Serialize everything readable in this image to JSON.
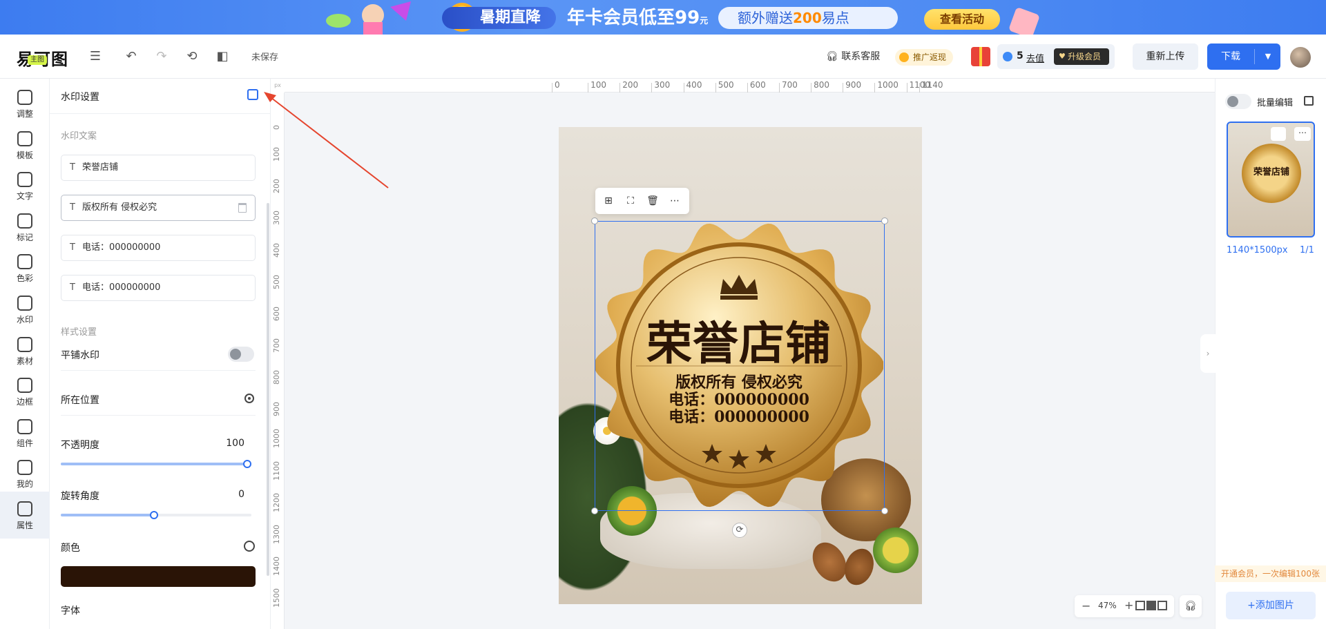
{
  "banner": {
    "pill1": "暑期直降",
    "pill2": "年卡会员低至99",
    "pill2_unit": "元",
    "pill3_prefix": "额外赠送",
    "pill3_number": "200",
    "pill3_suffix": "易点",
    "cta": "查看活动"
  },
  "topbar": {
    "logo": "易可图",
    "unsaved": "未保存",
    "contact": "联系客服",
    "promo": "推广返现",
    "points_count": "5",
    "recharge": "去值",
    "upgrade": "升级会员",
    "reupload": "重新上传",
    "download": "下载"
  },
  "rail": {
    "badge": "主图",
    "items": [
      {
        "label": "调整",
        "icon": "sliders-icon"
      },
      {
        "label": "模板",
        "icon": "template-grid-icon"
      },
      {
        "label": "文字",
        "icon": "text-icon"
      },
      {
        "label": "标记",
        "icon": "mark-icon"
      },
      {
        "label": "色彩",
        "icon": "palette-icon"
      },
      {
        "label": "水印",
        "icon": "stamp-icon"
      },
      {
        "label": "素材",
        "icon": "material-icon"
      },
      {
        "label": "边框",
        "icon": "border-icon"
      },
      {
        "label": "组件",
        "icon": "component-cube-icon"
      },
      {
        "label": "我的",
        "icon": "user-icon"
      },
      {
        "label": "属性",
        "icon": "layers-icon"
      }
    ],
    "active_index": 10
  },
  "panel": {
    "title": "水印设置",
    "text_section": "水印文案",
    "watermark_texts": [
      "荣誉店铺",
      "版权所有 侵权必究",
      "电话：000000000",
      "电话：000000000"
    ],
    "style_section": "样式设置",
    "tile_watermark": "平铺水印",
    "position": "所在位置",
    "opacity_label": "不透明度",
    "opacity_value": "100",
    "opacity_fraction": 1.0,
    "rotation_label": "旋转角度",
    "rotation_value": "0",
    "rotation_fraction": 0.5,
    "color_label": "颜色",
    "color_value": "#2a1406",
    "font_label": "字体"
  },
  "ruler": {
    "unit": "px",
    "top_ticks": [
      "0",
      "100",
      "200",
      "300",
      "400",
      "500",
      "600",
      "700",
      "800",
      "900",
      "1000",
      "1100",
      "1140"
    ],
    "left_ticks": [
      "0",
      "100",
      "200",
      "300",
      "400",
      "500",
      "600",
      "700",
      "800",
      "900",
      "1000",
      "1100",
      "1200",
      "1300",
      "1400",
      "1500"
    ]
  },
  "seal": {
    "title": "荣誉店铺",
    "line1": "版权所有 侵权必究",
    "line2": "电话：000000000",
    "line3": "电话：000000000"
  },
  "float_toolbar": [
    "replace-image-icon",
    "crop-icon",
    "delete-icon",
    "more-icon"
  ],
  "right": {
    "batch_edit": "批量编辑",
    "size": "1140*1500px",
    "page": "1/1",
    "vip_note": "开通会员，一次编辑100张",
    "add_image": "+添加图片"
  },
  "zoom": {
    "percent": "47%"
  }
}
